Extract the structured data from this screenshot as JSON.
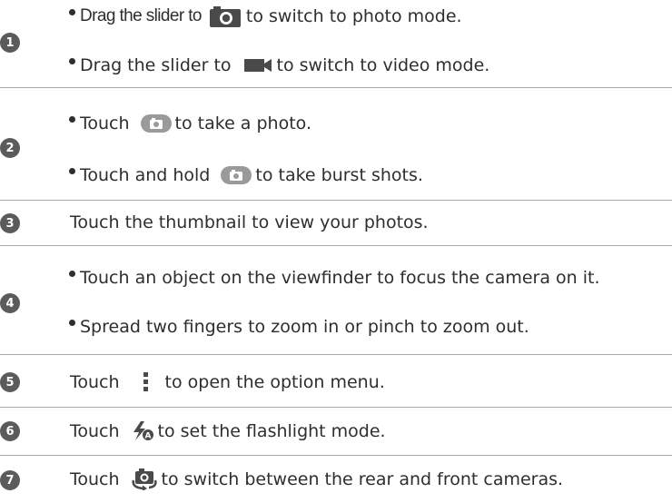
{
  "rows": [
    {
      "number": "1",
      "lines": [
        {
          "before": "Drag the slider to",
          "icon": "camera-icon",
          "after": "to switch to photo mode."
        },
        {
          "before": "Drag the slider to",
          "icon": "video-camera-icon",
          "after": "to switch to video mode."
        }
      ]
    },
    {
      "number": "2",
      "lines": [
        {
          "before": "Touch",
          "icon": "shutter-button-icon",
          "after": "to take a photo."
        },
        {
          "before": "Touch and hold",
          "icon": "shutter-button-icon",
          "after": "to take burst shots."
        }
      ]
    },
    {
      "number": "3",
      "text": "Touch the thumbnail to view your photos."
    },
    {
      "number": "4",
      "lines": [
        {
          "text": "Touch an object on the viewfinder to focus the camera on it."
        },
        {
          "text": "Spread two fingers to zoom in or pinch to zoom out."
        }
      ]
    },
    {
      "number": "5",
      "before": "Touch",
      "icon": "more-options-icon",
      "after": "to open the option menu."
    },
    {
      "number": "6",
      "before": "Touch",
      "icon": "flash-auto-icon",
      "after": "to set the flashlight mode."
    },
    {
      "number": "7",
      "before": "Touch",
      "icon": "switch-camera-icon",
      "after": "to switch between the rear and front cameras."
    }
  ]
}
